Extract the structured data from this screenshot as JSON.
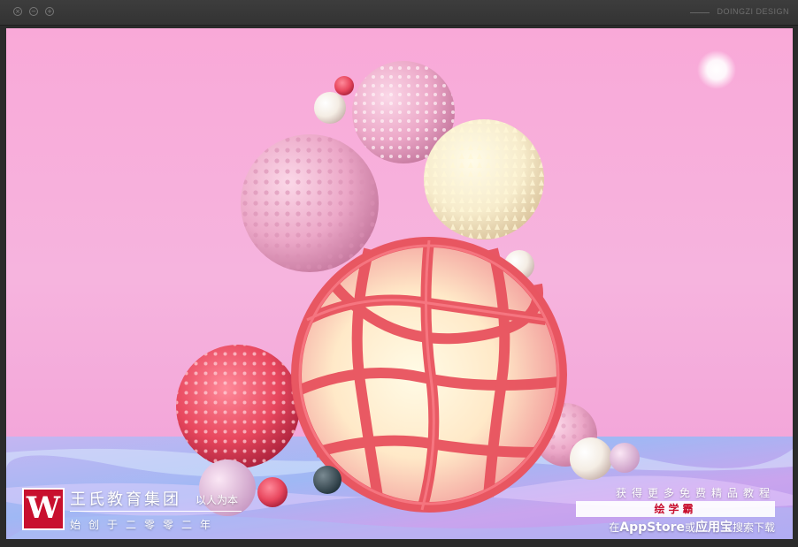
{
  "window": {
    "close_glyph": "×",
    "minimize_glyph": "−",
    "maximize_glyph": "+",
    "brand": "DOINGZI DESIGN"
  },
  "colors": {
    "background": "#f4a8d6",
    "accent_red": "#c8102e",
    "water": "#b8a8f0"
  },
  "watermark": {
    "logo_letter": "W",
    "org_name": "王氏教育集团",
    "motto": "以人为本",
    "founded": "始创于二零零二年",
    "promo_line1": "获得更多免费精品教程",
    "promo_app": "绘学霸",
    "promo_prefix": "在",
    "promo_store1": "AppStore",
    "promo_or": "或",
    "promo_store2": "应用宝",
    "promo_suffix": "搜索下载"
  }
}
